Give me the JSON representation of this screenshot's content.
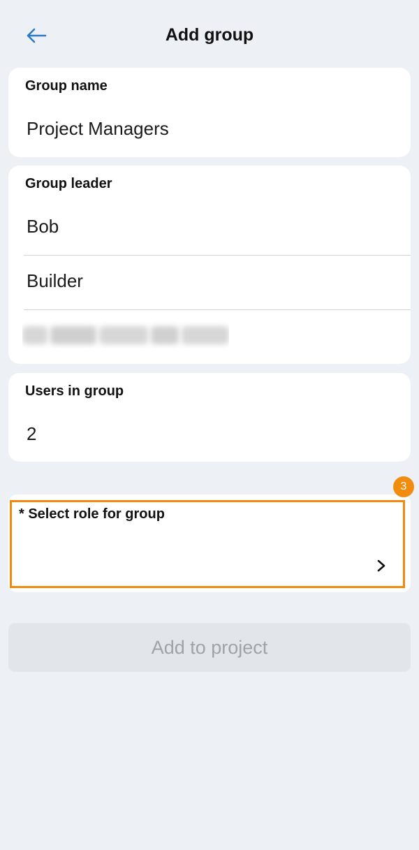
{
  "header": {
    "title": "Add group",
    "back_icon": "arrow-left-icon",
    "accent_color": "#2b7ac6"
  },
  "group_name": {
    "label": "Group name",
    "value": "Project Managers"
  },
  "group_leader": {
    "label": "Group leader",
    "first_name": "Bob",
    "last_name": "Builder"
  },
  "users_in_group": {
    "label": "Users in group",
    "value": "2"
  },
  "role": {
    "label": "* Select role for group",
    "chevron_icon": "chevron-right-icon",
    "badge": "3",
    "highlight_color": "#f0890c"
  },
  "actions": {
    "add_label": "Add to project"
  }
}
